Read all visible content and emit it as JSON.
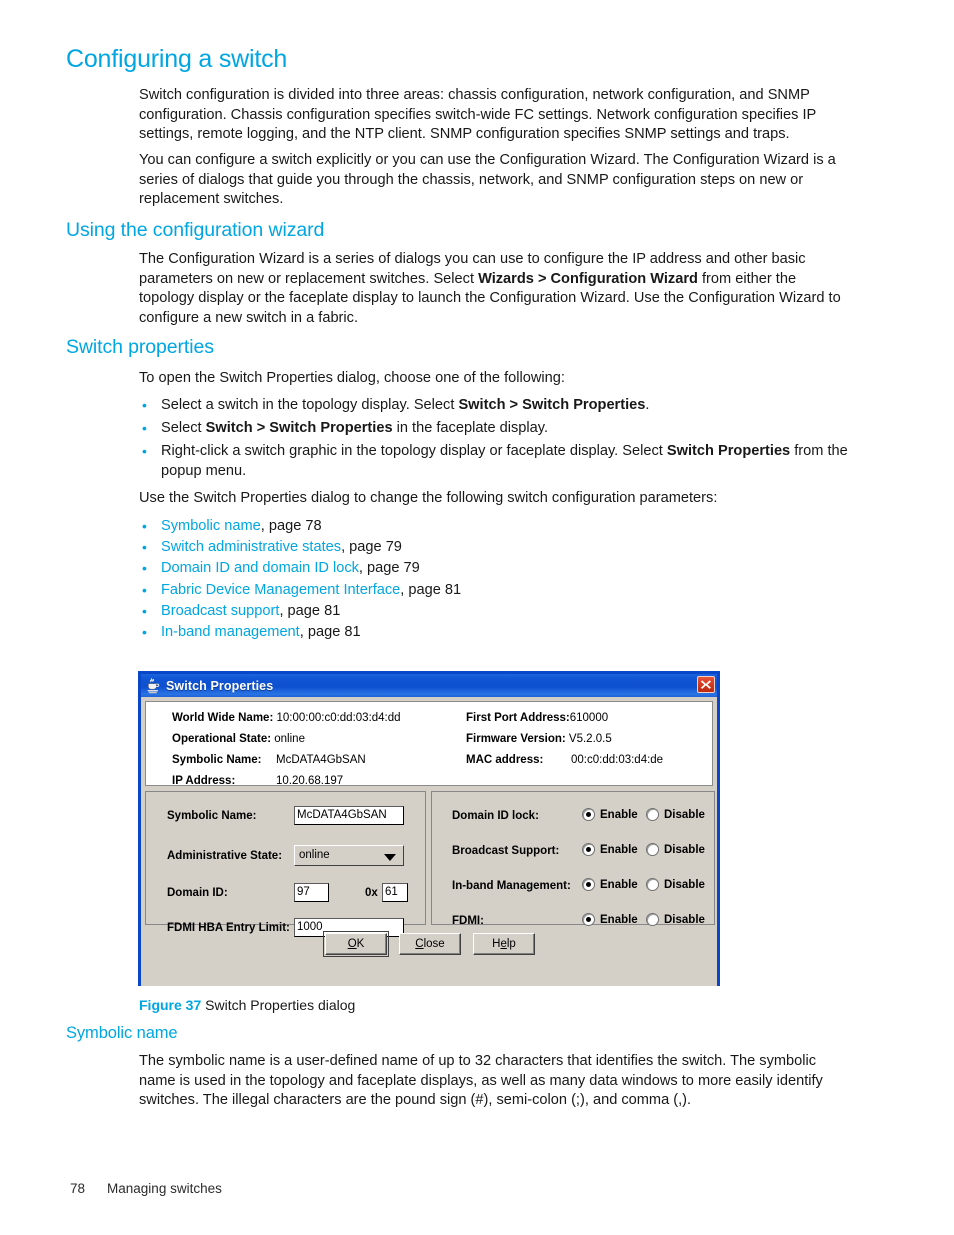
{
  "colors": {
    "heading": "#00A6E2",
    "link": "#00A6E2",
    "body": "#181818",
    "dialog_titlebar": "#0d4fd0",
    "dialog_face": "#d4d0c8",
    "dialog_border": "#0a46c8",
    "close_button": "#cc3319"
  },
  "headings": {
    "title": "Configuring a switch",
    "section_wizard": "Using the configuration wizard",
    "section_switch_properties": "Switch properties",
    "subsection_symbolic_name": "Symbolic name"
  },
  "paragraphs": {
    "intro_1": "Switch configuration is divided into three areas: chassis configuration, network configuration, and SNMP configuration. Chassis configuration specifies switch-wide FC settings. Network configuration specifies IP settings, remote logging, and the NTP client. SNMP configuration specifies SNMP settings and traps.",
    "intro_2": "You can configure a switch explicitly or you can use the Configuration Wizard. The Configuration Wizard is a series of dialogs that guide you through the chassis, network, and SNMP configuration steps on new or replacement switches.",
    "wizard_body_pre": "The Configuration Wizard is a series of dialogs you can use to configure the IP address and other basic parameters on new or replacement switches. Select ",
    "wizard_body_bold": "Wizards > Configuration Wizard",
    "wizard_body_post": " from either the topology display or the faceplate display to launch the Configuration Wizard. Use the Configuration Wizard to configure a new switch in a fabric.",
    "open_dialog_intro": "To open the Switch Properties dialog, choose one of the following:",
    "use_dialog_intro": "Use the Switch Properties dialog to change the following switch configuration parameters:",
    "symbolic_name_body": "The symbolic name is a user-defined name of up to 32 characters that identifies the switch. The symbolic name is used in the topology and faceplate displays, as well as many data windows to more easily identify switches. The illegal characters are the pound sign (#), semi-colon (;), and comma (,)."
  },
  "open_dialog_bullets": [
    {
      "pre": "Select a switch in the topology display. Select ",
      "bold": "Switch > Switch Properties",
      "post": "."
    },
    {
      "pre": "Select ",
      "bold": "Switch > Switch Properties",
      "post": " in the faceplate display."
    },
    {
      "pre": "Right-click a switch graphic in the topology display or faceplate display. Select ",
      "bold": "Switch Properties",
      "post": " from the popup menu."
    }
  ],
  "param_bullets": [
    {
      "link": "Symbolic name",
      "rest": ", page 78"
    },
    {
      "link": "Switch administrative states",
      "rest": ", page 79"
    },
    {
      "link": "Domain ID and domain ID lock",
      "rest": ", page 79"
    },
    {
      "link": "Fabric Device Management Interface",
      "rest": ", page 81"
    },
    {
      "link": "Broadcast support",
      "rest": ", page 81"
    },
    {
      "link": "In-band management",
      "rest": ", page 81"
    }
  ],
  "dialog": {
    "icon": "java-coffee-cup-icon",
    "title": "Switch Properties",
    "close_icon": "close-icon",
    "info": {
      "world_wide_name_label": "World Wide Name:",
      "world_wide_name_value": "10:00:00:c0:dd:03:d4:dd",
      "operational_state_label": "Operational State:",
      "operational_state_value": "online",
      "symbolic_name_label": "Symbolic Name:",
      "symbolic_name_value": "McDATA4GbSAN",
      "ip_address_label": "IP Address:",
      "ip_address_value": "10.20.68.197",
      "first_port_address_label": "First Port Address:",
      "first_port_address_value": "610000",
      "firmware_version_label": "Firmware Version:",
      "firmware_version_value": "V5.2.0.5",
      "mac_address_label": "MAC address:",
      "mac_address_value": "00:c0:dd:03:d4:de"
    },
    "form": {
      "symbolic_name_label": "Symbolic Name:",
      "symbolic_name_value": "McDATA4GbSAN",
      "administrative_state_label": "Administrative State:",
      "administrative_state_value": "online",
      "domain_id_label": "Domain ID:",
      "domain_id_value": "97",
      "domain_id_hex_prefix": "0x",
      "domain_id_hex_value": "61",
      "fdmi_hba_entry_limit_label": "FDMI HBA Entry Limit:",
      "fdmi_hba_entry_limit_value": "1000"
    },
    "toggles": [
      {
        "label": "Domain ID lock:",
        "enable_label": "Enable",
        "disable_label": "Disable",
        "selected": "Enable"
      },
      {
        "label": "Broadcast Support:",
        "enable_label": "Enable",
        "disable_label": "Disable",
        "selected": "Enable"
      },
      {
        "label": "In-band Management:",
        "enable_label": "Enable",
        "disable_label": "Disable",
        "selected": "Enable"
      },
      {
        "label": "FDMI:",
        "enable_label": "Enable",
        "disable_label": "Disable",
        "selected": "Enable"
      }
    ],
    "buttons": {
      "ok": "OK",
      "ok_mnemonic": "O",
      "close": "Close",
      "close_mnemonic": "C",
      "help": "Help",
      "help_mnemonic": "e"
    }
  },
  "figure": {
    "number": "Figure 37",
    "caption": "Switch Properties dialog"
  },
  "footer": {
    "page_number": "78",
    "chapter": "Managing switches"
  }
}
